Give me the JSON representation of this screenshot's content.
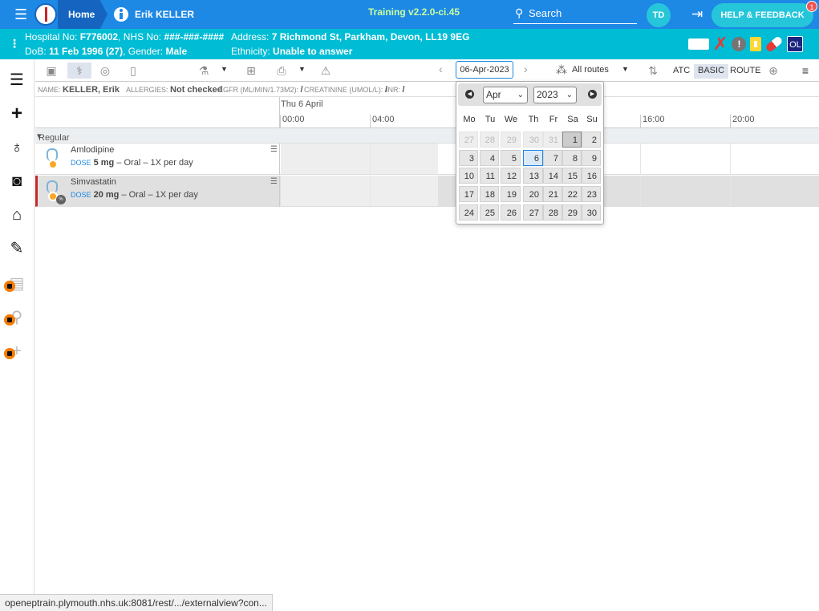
{
  "topbar": {
    "home_label": "Home",
    "patient_name": "Erik KELLER",
    "environment": "Training v2.2.0-ci.45",
    "search_label": "Search",
    "user_initials": "TD",
    "help_label": "HELP & FEEDBACK",
    "help_badge": "1"
  },
  "patient": {
    "hospital_label": "Hospital No: ",
    "hospital_no": "F776002",
    "nhs_label": ", NHS No: ",
    "nhs_no": "###-###-####",
    "dob_label": "DoB: ",
    "dob": "11 Feb 1996 (27)",
    "gender_label": ", Gender: ",
    "gender": "Male",
    "address_label": "Address: ",
    "address": "7 Richmond St, Parkham, Devon, LL19 9EG",
    "ethnicity_label": "Ethnicity: ",
    "ethnicity": "Unable to answer",
    "badge_ol": "OL"
  },
  "toolbar": {
    "date": "06-Apr-2023",
    "routes": "All routes",
    "atc": "ATC",
    "basic": "BASIC",
    "route": "ROUTE"
  },
  "infobar": {
    "name_label": "NAME:",
    "name": "KELLER, Erik",
    "allergies_label": "ALLERGIES:",
    "allergies": "Not checked",
    "egfr_label": "EGFR (ML/MIN/1.73M2):",
    "egfr": "/",
    "creatinine_label": "CREATININE (UMOL/L):",
    "creatinine": "/",
    "inr_label": "INR:",
    "inr": "/"
  },
  "timeline": {
    "day": "Thu 6 April",
    "hours": [
      "00:00",
      "04:00",
      "16:00",
      "20:00"
    ]
  },
  "group": {
    "label": "Regular"
  },
  "meds": [
    {
      "name": "Amlodipine",
      "dose_label": "DOSE",
      "dose": "5 mg",
      "details": " – Oral – 1X per day"
    },
    {
      "name": "Simvastatin",
      "dose_label": "DOSE",
      "dose": "20 mg",
      "details": " – Oral – 1X per day"
    }
  ],
  "datepicker": {
    "month": "Apr",
    "year": "2023",
    "weekdays": [
      "Mo",
      "Tu",
      "We",
      "Th",
      "Fr",
      "Sa",
      "Su"
    ],
    "weeks": [
      [
        "27",
        "28",
        "29",
        "30",
        "31",
        "1",
        "2"
      ],
      [
        "3",
        "4",
        "5",
        "6",
        "7",
        "8",
        "9"
      ],
      [
        "10",
        "11",
        "12",
        "13",
        "14",
        "15",
        "16"
      ],
      [
        "17",
        "18",
        "19",
        "20",
        "21",
        "22",
        "23"
      ],
      [
        "24",
        "25",
        "26",
        "27",
        "28",
        "29",
        "30"
      ]
    ]
  },
  "status_url": "openeptrain.plymouth.nhs.uk:8081/rest/.../externalview?con..."
}
